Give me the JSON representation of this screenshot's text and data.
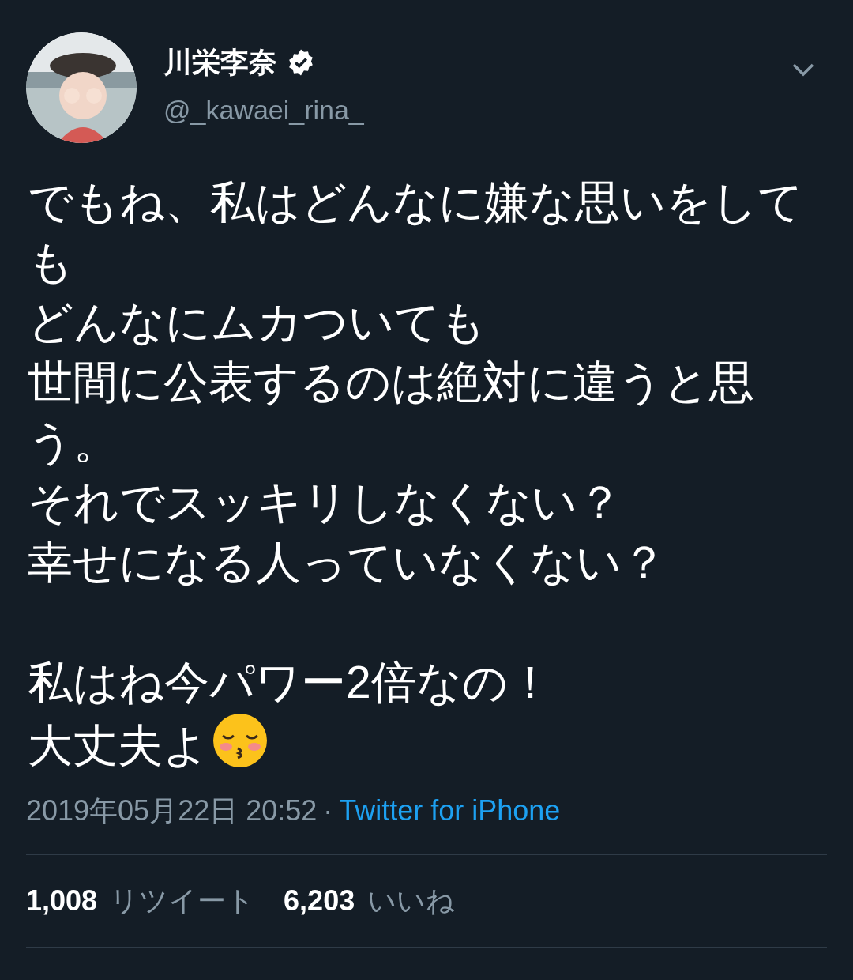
{
  "author": {
    "name": "川栄李奈",
    "verified": true,
    "handle": "@_kawaei_rina_"
  },
  "paragraphs": [
    {
      "lines": [
        "でもね、私はどんなに嫌な思いをしても",
        "どんなにムカついても",
        "世間に公表するのは絶対に違うと思う。",
        "それでスッキリしなくない？",
        "幸せになる人っていなくない？"
      ]
    },
    {
      "lines": [
        "私はね今パワー2倍なの！",
        "大丈夫よ"
      ],
      "ends_with_emoji": true
    }
  ],
  "timestamp": "2019年05月22日 20:52",
  "separator": "·",
  "source": "Twitter for iPhone",
  "stats": [
    {
      "count": "1,008",
      "label": "リツイート"
    },
    {
      "count": "6,203",
      "label": "いいね"
    }
  ]
}
